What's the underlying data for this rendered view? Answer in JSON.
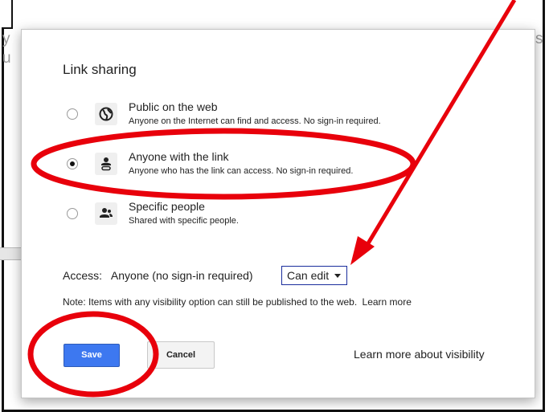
{
  "dialog": {
    "title": "Link sharing",
    "options": [
      {
        "title": "Public on the web",
        "description": "Anyone on the Internet can find and access. No sign-in required.",
        "icon": "globe-icon",
        "checked": false
      },
      {
        "title": "Anyone with the link",
        "description": "Anyone who has the link can access. No sign-in required.",
        "icon": "link-person-icon",
        "checked": true
      },
      {
        "title": "Specific people",
        "description": "Shared with specific people.",
        "icon": "people-icon",
        "checked": false
      }
    ],
    "access": {
      "label": "Access:",
      "value": "Anyone (no sign-in required)",
      "dropdown_selected": "Can edit"
    },
    "note": {
      "text": "Note: Items with any visibility option can still be published to the web.",
      "link": "Learn more"
    },
    "buttons": {
      "save": "Save",
      "cancel": "Cancel"
    },
    "learn_more_visibility": "Learn more about visibility"
  },
  "background": {
    "fragments": [
      "y",
      "u",
      "s"
    ]
  },
  "colors": {
    "save_button": "#3d78f0",
    "annotation": "#e8000b",
    "dropdown_border": "#1a2d9c"
  }
}
